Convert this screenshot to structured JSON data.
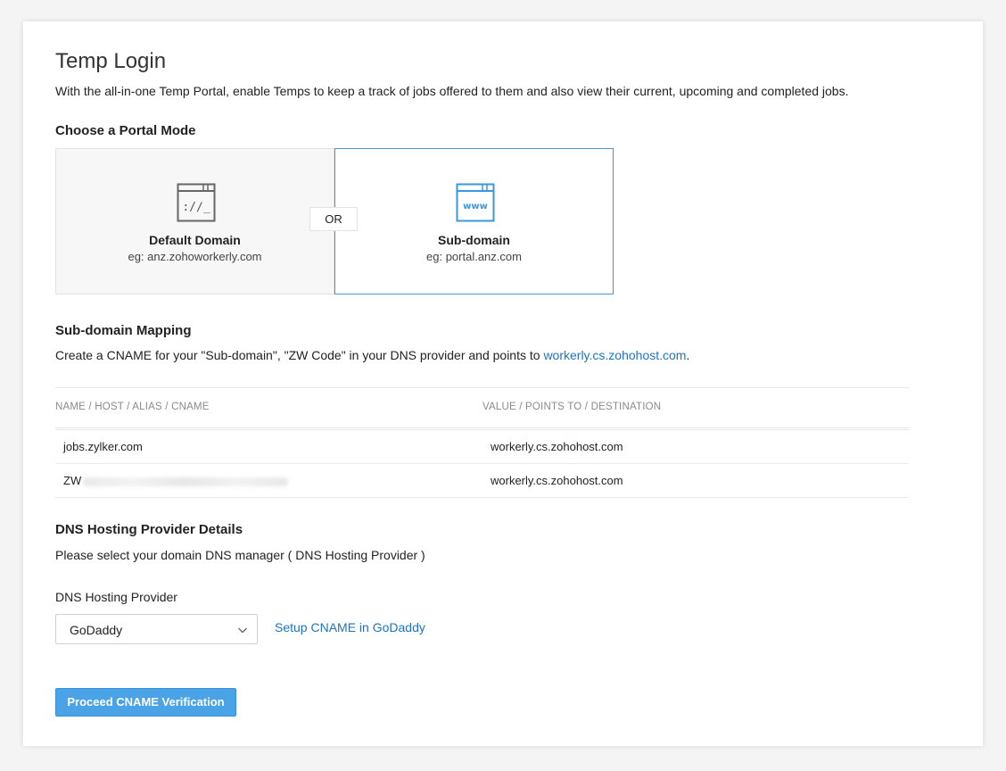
{
  "page": {
    "title": "Temp Login",
    "description": "With the all-in-one Temp Portal, enable Temps to keep a track of jobs offered to them and also view their current, upcoming and completed jobs."
  },
  "portal_mode": {
    "heading": "Choose a Portal Mode",
    "or_label": "OR",
    "default": {
      "name": "Default Domain",
      "example": "eg: anz.zohoworkerly.com",
      "icon": "browser-url-icon"
    },
    "subdomain": {
      "name": "Sub-domain",
      "example": "eg: portal.anz.com",
      "icon": "browser-www-icon",
      "selected": true
    }
  },
  "mapping": {
    "heading": "Sub-domain Mapping",
    "instruction_prefix": "Create a CNAME for your \"Sub-domain\", \"ZW Code\" in your DNS provider and points to ",
    "instruction_link": "workerly.cs.zohohost.com",
    "instruction_suffix": ".",
    "table": {
      "columns": [
        "NAME / HOST / ALIAS / CNAME",
        "VALUE / POINTS TO / DESTINATION"
      ],
      "rows": [
        {
          "name": "jobs.zylker.com",
          "value": "workerly.cs.zohohost.com"
        },
        {
          "name": "ZW",
          "value": "workerly.cs.zohohost.com",
          "name_redacted": true
        }
      ]
    }
  },
  "dns": {
    "heading": "DNS Hosting Provider Details",
    "instruction": "Please select your domain DNS manager ( DNS Hosting Provider )",
    "field_label": "DNS Hosting Provider",
    "selected_provider": "GoDaddy",
    "setup_link": "Setup CNAME in GoDaddy"
  },
  "actions": {
    "proceed_label": "Proceed CNAME Verification"
  },
  "colors": {
    "accent": "#3a97e0",
    "link": "#1e73be",
    "button": "#4aa3e6"
  }
}
